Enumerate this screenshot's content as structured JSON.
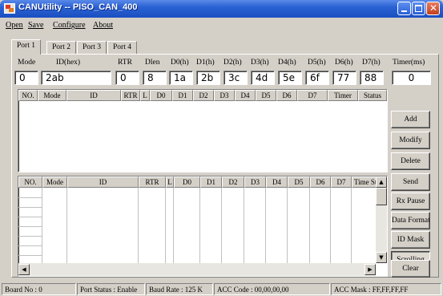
{
  "window": {
    "title": "CANUtility -- PISO_CAN_400"
  },
  "menu": [
    "Open",
    "Save",
    "Configure",
    "About"
  ],
  "tabs": [
    "Port 1",
    "Port 2",
    "Port 3",
    "Port 4"
  ],
  "fields": {
    "labels": [
      "Mode",
      "ID(hex)",
      "RTR",
      "Dlen",
      "D0(h)",
      "D1(h)",
      "D2(h)",
      "D3(h)",
      "D4(h)",
      "D5(h)",
      "D6(h)",
      "D7(h)",
      "Timer(ms)"
    ],
    "values": {
      "mode": "0",
      "id": "2ab",
      "rtr": "0",
      "dlen": "8",
      "d0": "1a",
      "d1": "2b",
      "d2": "3c",
      "d3": "4d",
      "d4": "5e",
      "d5": "6f",
      "d6": "77",
      "d7": "88",
      "timer": "0"
    }
  },
  "send_list": {
    "columns": [
      "NO.",
      "Mode",
      "ID",
      "RTR",
      "L",
      "D0",
      "D1",
      "D2",
      "D3",
      "D4",
      "D5",
      "D6",
      "D7",
      "Timer",
      "Status"
    ]
  },
  "recv_list": {
    "columns": [
      "NO.",
      "Mode",
      "ID",
      "RTR",
      "L",
      "D0",
      "D1",
      "D2",
      "D3",
      "D4",
      "D5",
      "D6",
      "D7",
      "Time Stamps(s)"
    ]
  },
  "buttons": {
    "add": "Add",
    "modify": "Modify",
    "delete": "Delete",
    "send": "Send",
    "rx_pause": "Rx Pause",
    "data_format": "Data Format",
    "id_mask": "ID Mask",
    "scrolling": "Scrolling",
    "clear": "Clear"
  },
  "status": {
    "board": "Board No : 0",
    "port": "Port Status : Enable",
    "baud": "Baud Rate : 125 K",
    "acc_code": "ACC Code : 00,00,00,00",
    "acc_mask": "ACC Mask : FF,FF,FF,FF"
  }
}
